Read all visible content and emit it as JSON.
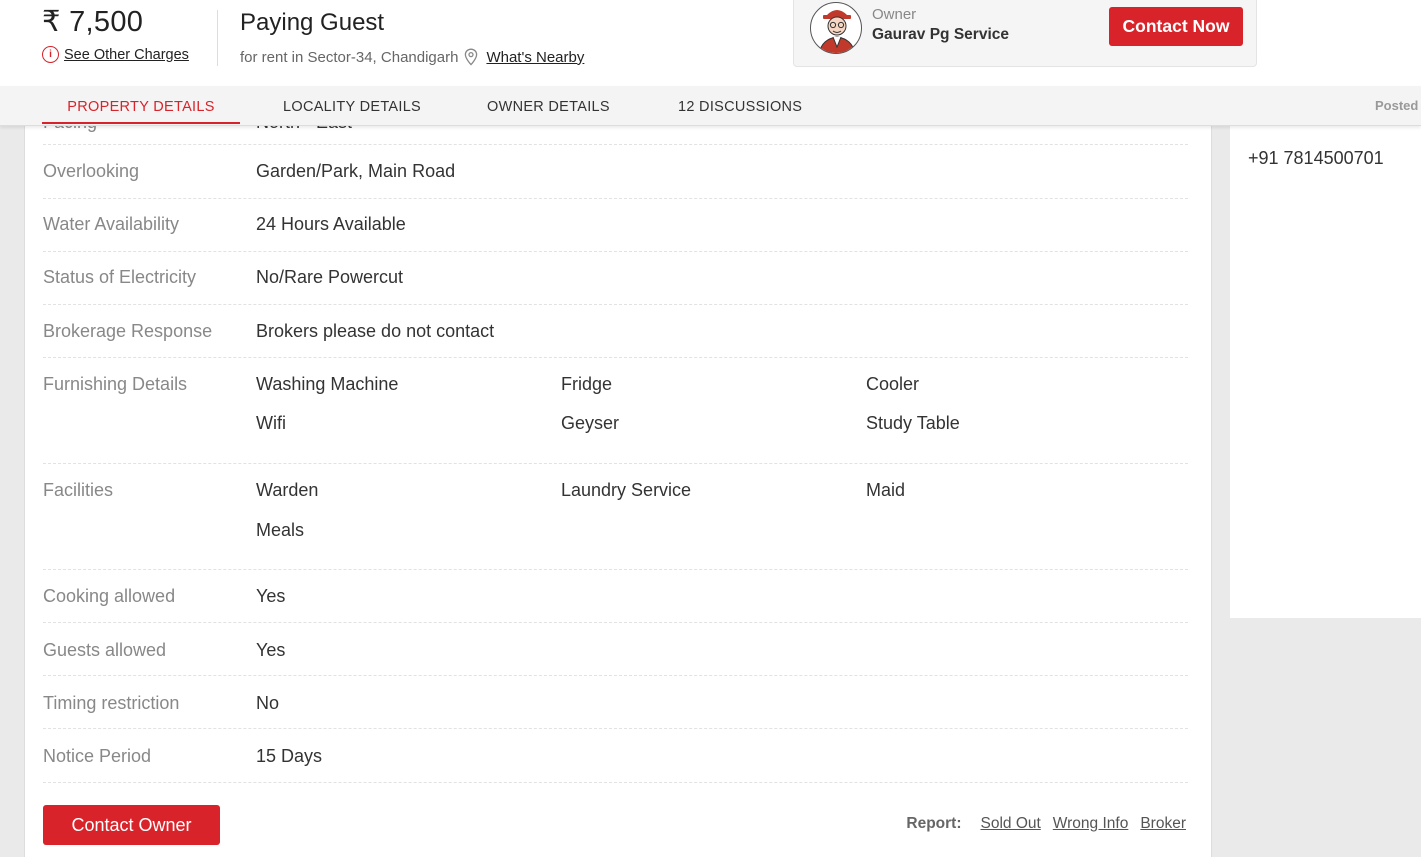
{
  "header": {
    "price": "₹ 7,500",
    "other_charges": "See Other Charges",
    "property_type": "Paying Guest",
    "location": "for rent in Sector-34, Chandigarh",
    "whats_nearby": "What's Nearby",
    "owner_role": "Owner",
    "owner_name": "Gaurav Pg Service",
    "contact_now": "Contact Now"
  },
  "tabs": [
    {
      "label": "PROPERTY DETAILS",
      "active": true
    },
    {
      "label": "LOCALITY DETAILS",
      "active": false
    },
    {
      "label": "OWNER DETAILS",
      "active": false
    },
    {
      "label": "12 DISCUSSIONS",
      "active": false
    }
  ],
  "posted_partial": "Posted o",
  "details": {
    "facing": {
      "label": "Facing",
      "value": "North - East"
    },
    "overlooking": {
      "label": "Overlooking",
      "value": "Garden/Park, Main Road"
    },
    "water": {
      "label": "Water Availability",
      "value": "24 Hours Available"
    },
    "electricity": {
      "label": "Status of Electricity",
      "value": "No/Rare Powercut"
    },
    "brokerage": {
      "label": "Brokerage Response",
      "value": "Brokers please do not contact"
    },
    "furnishing": {
      "label": "Furnishing Details",
      "items": [
        "Washing Machine",
        "Fridge",
        "Cooler",
        "Wifi",
        "Geyser",
        "Study Table"
      ]
    },
    "facilities": {
      "label": "Facilities",
      "items": [
        "Warden",
        "Laundry Service",
        "Maid",
        "Meals"
      ]
    },
    "cooking": {
      "label": "Cooking allowed",
      "value": "Yes"
    },
    "guests": {
      "label": "Guests allowed",
      "value": "Yes"
    },
    "timing": {
      "label": "Timing restriction",
      "value": "No"
    },
    "notice": {
      "label": "Notice Period",
      "value": "15 Days"
    }
  },
  "footer": {
    "contact_owner": "Contact Owner",
    "report_label": "Report:",
    "report_links": [
      "Sold Out",
      "Wrong Info",
      "Broker"
    ]
  },
  "side": {
    "phone": "+91 7814500701"
  },
  "colors": {
    "accent": "#d8232a",
    "label": "#888888",
    "value": "#333333",
    "background": "#eaeaea"
  },
  "icons": [
    "info-icon",
    "location-pin-icon",
    "owner-avatar-icon"
  ]
}
